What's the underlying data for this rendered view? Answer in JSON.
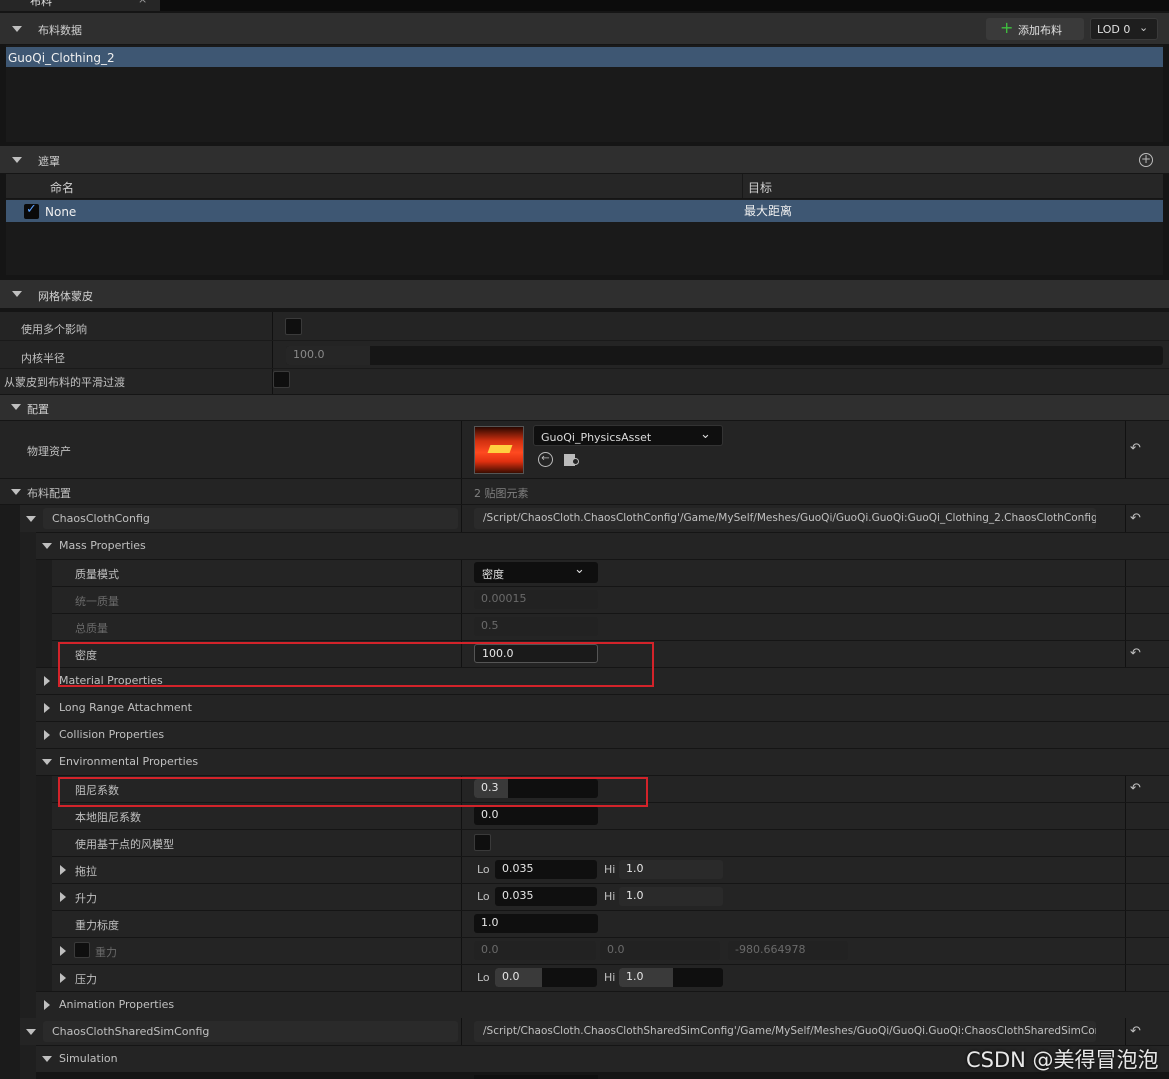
{
  "tab": {
    "label": "布料"
  },
  "cloth_data": {
    "header": "布料数据",
    "add_button": "添加布料",
    "lod": "LOD 0",
    "items": [
      "GuoQi_Clothing_2"
    ]
  },
  "masks": {
    "header": "遮罩",
    "col_name": "命名",
    "col_target": "目标",
    "rows": [
      {
        "name": "None",
        "target": "最大距离"
      }
    ]
  },
  "skinning": {
    "header": "网格体蒙皮",
    "multi_influence": "使用多个影响",
    "kernel_radius": "内核半径",
    "kernel_radius_value": "100.0",
    "smooth_transition": "从蒙皮到布料的平滑过渡"
  },
  "config": {
    "header": "配置",
    "physics_asset_label": "物理资产",
    "physics_asset_value": "GuoQi_PhysicsAsset",
    "cloth_config_label": "布料配置",
    "cloth_config_count": "2 贴图元素",
    "chaos_config_name": "ChaosClothConfig",
    "chaos_config_path": "/Script/ChaosCloth.ChaosClothConfig'/Game/MySelf/Meshes/GuoQi/GuoQi.GuoQi:GuoQi_Clothing_2.ChaosClothConfig'",
    "mass": {
      "header": "Mass Properties",
      "mode_label": "质量模式",
      "mode_value": "密度",
      "uniform_label": "统一质量",
      "uniform_value": "0.00015",
      "total_label": "总质量",
      "total_value": "0.5",
      "density_label": "密度",
      "density_value": "100.0"
    },
    "material_header": "Material Properties",
    "long_range_header": "Long Range Attachment",
    "collision_header": "Collision Properties",
    "env": {
      "header": "Environmental Properties",
      "damping_label": "阻尼系数",
      "damping_value": "0.3",
      "local_damping_label": "本地阻尼系数",
      "local_damping_value": "0.0",
      "point_wind_label": "使用基于点的风模型",
      "drag_label": "拖拉",
      "drag_lo": "0.035",
      "drag_hi": "1.0",
      "lift_label": "升力",
      "lift_lo": "0.035",
      "lift_hi": "1.0",
      "gravity_scale_label": "重力标度",
      "gravity_scale_value": "1.0",
      "gravity_label": "重力",
      "gravity_x": "0.0",
      "gravity_y": "0.0",
      "gravity_z": "-980.664978",
      "pressure_label": "压力",
      "pressure_lo": "0.0",
      "pressure_hi": "1.0",
      "lo": "Lo",
      "hi": "Hi"
    },
    "animation_header": "Animation Properties",
    "shared_config_name": "ChaosClothSharedSimConfig",
    "shared_config_path": "/Script/ChaosCloth.ChaosClothSharedSimConfig'/Game/MySelf/Meshes/GuoQi/GuoQi.GuoQi:ChaosClothSharedSimConfig'",
    "simulation_header": "Simulation"
  },
  "watermark": "CSDN @美得冒泡泡",
  "colors": {
    "selection": "#3e5773",
    "highlight_box": "#d3232a",
    "add_icon": "#3fbf3f"
  }
}
